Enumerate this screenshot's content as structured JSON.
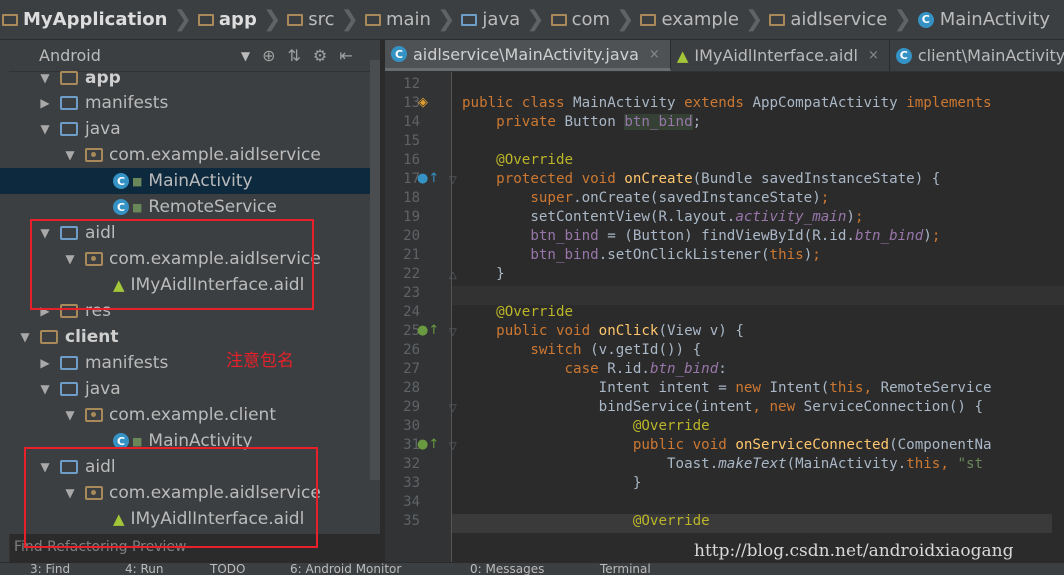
{
  "breadcrumb": [
    "MyApplication",
    "app",
    "src",
    "main",
    "java",
    "com",
    "example",
    "aidlservice",
    "MainActivity"
  ],
  "project_panel": {
    "view_label": "Android",
    "tree": [
      {
        "label": "app"
      },
      {
        "label": "manifests"
      },
      {
        "label": "java"
      },
      {
        "label": "com.example.aidlservice"
      },
      {
        "label": "MainActivity"
      },
      {
        "label": "RemoteService"
      },
      {
        "label": "aidl"
      },
      {
        "label": "com.example.aidlservice"
      },
      {
        "label": "IMyAidlInterface.aidl"
      },
      {
        "label": "res"
      },
      {
        "label": "client"
      },
      {
        "label": "manifests"
      },
      {
        "label": "java"
      },
      {
        "label": "com.example.client"
      },
      {
        "label": "MainActivity"
      },
      {
        "label": "aidl"
      },
      {
        "label": "com.example.aidlservice"
      },
      {
        "label": "IMyAidlInterface.aidl"
      }
    ],
    "annotation": "注意包名",
    "find_label": "Find Refactoring Preview"
  },
  "tabs": [
    {
      "label": "aidlservice\\MainActivity.java",
      "close": "×"
    },
    {
      "label": "IMyAidlInterface.aidl",
      "close": "×"
    },
    {
      "label": "client\\MainActivity.java",
      "close": "×"
    }
  ],
  "editor": {
    "line_numbers": [
      "12",
      "13",
      "14",
      "15",
      "16",
      "17",
      "18",
      "19",
      "20",
      "21",
      "22",
      "23",
      "24",
      "25",
      "26",
      "27",
      "28",
      "29",
      "30",
      "31",
      "32",
      "33",
      "34",
      "35"
    ]
  },
  "watermark": "http://blog.csdn.net/androidxiaogang",
  "status_bar": [
    "3: Find",
    "4: Run",
    "TODO",
    "6: Android Monitor",
    "0: Messages",
    "Terminal"
  ],
  "colors": {
    "annotation": "#e8202a",
    "selection": "#0d293e",
    "class_icon": "#3592c4",
    "android": "#a4c639"
  }
}
